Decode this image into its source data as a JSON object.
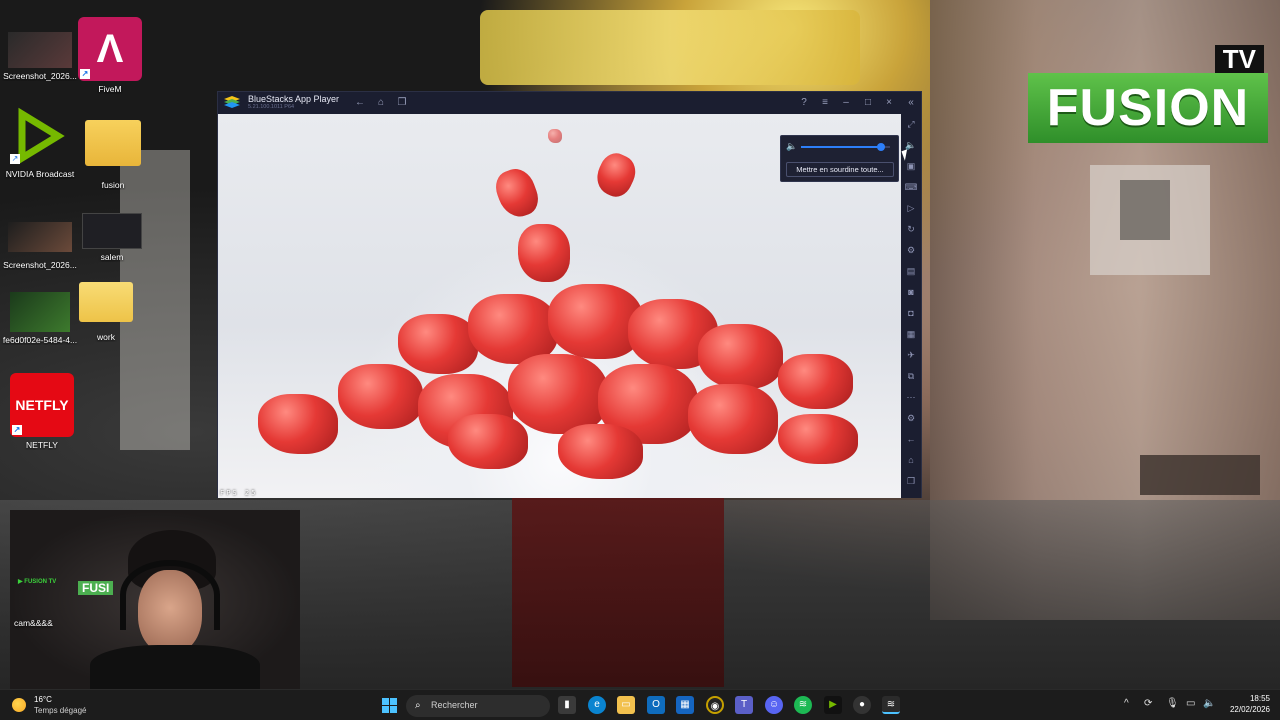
{
  "desktop": {
    "icons": [
      {
        "label": "Screenshot_2026..."
      },
      {
        "label": "FiveM"
      },
      {
        "label": "NVIDIA Broadcast"
      },
      {
        "label": "fusion"
      },
      {
        "label": "Screenshot_2026..."
      },
      {
        "label": "salem"
      },
      {
        "label": "fe6d0f02e-5484-4..."
      },
      {
        "label": "work"
      },
      {
        "label": "NETFLY"
      }
    ],
    "netfly_logo_text": "NETFLY"
  },
  "overlay": {
    "tv_text": "TV",
    "fusion_text": "FUSION",
    "webcam_brand": "FUSION TV",
    "webcam_badge": "FUSI",
    "webcam_label": "cam&&&&"
  },
  "bluestacks": {
    "title": "BlueStacks App Player",
    "version": "5.21.100.1011 P64",
    "fps_label": "FPS",
    "fps_value": "25",
    "volume": {
      "level": 0.9,
      "mute_all_label": "Mettre en sourdine toute..."
    }
  },
  "taskbar": {
    "weather_temp": "16°C",
    "weather_desc": "Temps dégagé",
    "search_placeholder": "Rechercher",
    "time": "18:55",
    "date": "22/02/2026"
  }
}
